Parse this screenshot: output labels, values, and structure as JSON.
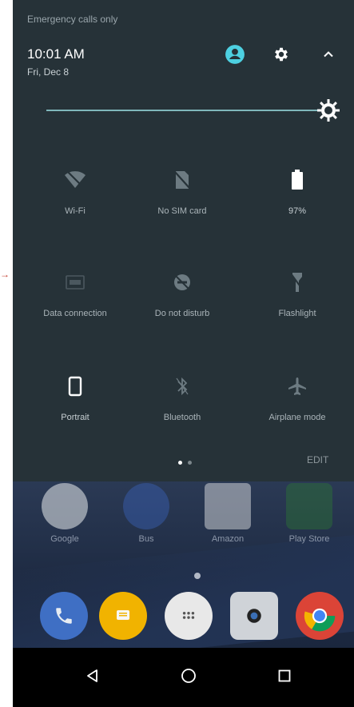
{
  "status_bar": {
    "text": "Emergency calls only"
  },
  "header": {
    "time": "10:01 AM",
    "date": "Fri, Dec 8",
    "icons": [
      "account-icon",
      "settings-icon",
      "collapse-chevron-icon"
    ]
  },
  "brightness": {
    "level": 1.0,
    "icon": "brightness-icon"
  },
  "tiles": [
    {
      "label": "Wi-Fi",
      "icon": "wifi-off-icon",
      "active": false
    },
    {
      "label": "No SIM card",
      "icon": "no-sim-icon",
      "active": false
    },
    {
      "label": "97%",
      "icon": "battery-icon",
      "active": true
    },
    {
      "label": "Data connection",
      "icon": "data-connection-icon",
      "active": false
    },
    {
      "label": "Do not disturb",
      "icon": "do-not-disturb-icon",
      "active": false
    },
    {
      "label": "Flashlight",
      "icon": "flashlight-icon",
      "active": false
    },
    {
      "label": "Portrait",
      "icon": "portrait-icon",
      "active": true
    },
    {
      "label": "Bluetooth",
      "icon": "bluetooth-icon",
      "active": false
    },
    {
      "label": "Airplane mode",
      "icon": "airplane-icon",
      "active": false
    }
  ],
  "pager": {
    "pages": 2,
    "current": 1
  },
  "edit_label": "EDIT",
  "home": {
    "apps": [
      {
        "label": "Google",
        "color": "#e9ecef"
      },
      {
        "label": "Bus",
        "color": "#3a62b8"
      },
      {
        "label": "Amazon",
        "color": "#f0f0f0"
      },
      {
        "label": "Play Store",
        "color": "#2e7d32"
      }
    ],
    "dock": [
      "phone-icon",
      "messages-icon",
      "app-drawer-icon",
      "camera-icon",
      "chrome-icon"
    ]
  },
  "navbar": [
    "back-icon",
    "home-icon",
    "recents-icon"
  ],
  "colors": {
    "shade": "#263238",
    "accent": "#4dd0e1",
    "icon_active": "#ffffff",
    "icon_inactive": "#6d7b82"
  }
}
